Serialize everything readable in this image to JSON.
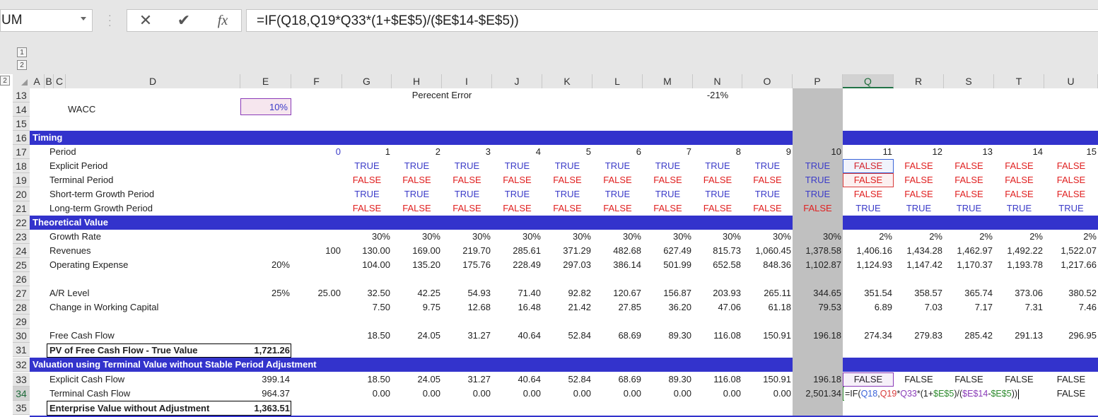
{
  "namebox": {
    "value": "UM"
  },
  "formula_bar": {
    "cancel_icon": "✕",
    "enter_icon": "✔",
    "fx_label": "fx",
    "formula": "=IF(Q18,Q19*Q33*(1+$E$5)/($E$14-$E$5))"
  },
  "outline": {
    "levels": [
      "1",
      "2"
    ],
    "level_2": "2"
  },
  "columns": [
    "A",
    "B",
    "C",
    "D",
    "E",
    "F",
    "G",
    "H",
    "I",
    "J",
    "K",
    "L",
    "M",
    "N",
    "O",
    "P",
    "Q",
    "R",
    "S",
    "T",
    "U"
  ],
  "rows": [
    "13",
    "14",
    "15",
    "16",
    "17",
    "18",
    "19",
    "20",
    "21",
    "22",
    "23",
    "24",
    "25",
    "26",
    "27",
    "28",
    "29",
    "30",
    "31",
    "32",
    "33",
    "34",
    "35"
  ],
  "sections": {
    "timing": "Timing",
    "theoretical": "Theoretical Value",
    "valuation": "Valuation using Terminal Value without Stable Period Adjustment"
  },
  "labels": {
    "perecent_error": "Perecent Error",
    "error_value": "-21%",
    "wacc": "WACC",
    "wacc_value": "10%",
    "period": "Period",
    "explicit_period": "Explicit Period",
    "terminal_period": "Terminal Period",
    "short_term": "Short-term Growth Period",
    "long_term": "Long-term Growth Period",
    "growth_rate": "Growth Rate",
    "revenues": "Revenues",
    "revenues_base": "100",
    "opex": "Operating Expense",
    "opex_pct": "20%",
    "ar_level": "A/R Level",
    "ar_pct": "25%",
    "ar_base": "25.00",
    "change_wc": "Change in Working Capital",
    "fcf": "Free Cash Flow",
    "pv_fcf": "PV of Free Cash Flow - True Value",
    "pv_fcf_value": "1,721.26",
    "explicit_cf": "Explicit Cash Flow",
    "explicit_cf_total": "399.14",
    "terminal_cf": "Terminal Cash Flow",
    "terminal_cf_total": "964.37",
    "ev_wo_adj": "Enterprise Value without Adjustment",
    "ev_wo_adj_value": "1,363.51"
  },
  "period_values": [
    "0",
    "1",
    "2",
    "3",
    "4",
    "5",
    "6",
    "7",
    "8",
    "9",
    "10",
    "11",
    "12",
    "13",
    "14",
    "15"
  ],
  "explicit_period": [
    "TRUE",
    "TRUE",
    "TRUE",
    "TRUE",
    "TRUE",
    "TRUE",
    "TRUE",
    "TRUE",
    "TRUE",
    "TRUE",
    "FALSE",
    "FALSE",
    "FALSE",
    "FALSE",
    "FALSE"
  ],
  "terminal_period": [
    "FALSE",
    "FALSE",
    "FALSE",
    "FALSE",
    "FALSE",
    "FALSE",
    "FALSE",
    "FALSE",
    "FALSE",
    "TRUE",
    "FALSE",
    "FALSE",
    "FALSE",
    "FALSE",
    "FALSE"
  ],
  "short_term": [
    "TRUE",
    "TRUE",
    "TRUE",
    "TRUE",
    "TRUE",
    "TRUE",
    "TRUE",
    "TRUE",
    "TRUE",
    "TRUE",
    "FALSE",
    "FALSE",
    "FALSE",
    "FALSE",
    "FALSE"
  ],
  "long_term": [
    "FALSE",
    "FALSE",
    "FALSE",
    "FALSE",
    "FALSE",
    "FALSE",
    "FALSE",
    "FALSE",
    "FALSE",
    "FALSE",
    "TRUE",
    "TRUE",
    "TRUE",
    "TRUE",
    "TRUE"
  ],
  "growth_rate": [
    "30%",
    "30%",
    "30%",
    "30%",
    "30%",
    "30%",
    "30%",
    "30%",
    "30%",
    "30%",
    "2%",
    "2%",
    "2%",
    "2%",
    "2%"
  ],
  "revenues": [
    "130.00",
    "169.00",
    "219.70",
    "285.61",
    "371.29",
    "482.68",
    "627.49",
    "815.73",
    "1,060.45",
    "1,378.58",
    "1,406.16",
    "1,434.28",
    "1,462.97",
    "1,492.22",
    "1,522.07"
  ],
  "opex": [
    "104.00",
    "135.20",
    "175.76",
    "228.49",
    "297.03",
    "386.14",
    "501.99",
    "652.58",
    "848.36",
    "1,102.87",
    "1,124.93",
    "1,147.42",
    "1,170.37",
    "1,193.78",
    "1,217.66"
  ],
  "ar_level": [
    "32.50",
    "42.25",
    "54.93",
    "71.40",
    "92.82",
    "120.67",
    "156.87",
    "203.93",
    "265.11",
    "344.65",
    "351.54",
    "358.57",
    "365.74",
    "373.06",
    "380.52"
  ],
  "change_wc": [
    "7.50",
    "9.75",
    "12.68",
    "16.48",
    "21.42",
    "27.85",
    "36.20",
    "47.06",
    "61.18",
    "79.53",
    "6.89",
    "7.03",
    "7.17",
    "7.31",
    "7.46"
  ],
  "fcf": [
    "18.50",
    "24.05",
    "31.27",
    "40.64",
    "52.84",
    "68.69",
    "89.30",
    "116.08",
    "150.91",
    "196.18",
    "274.34",
    "279.83",
    "285.42",
    "291.13",
    "296.95"
  ],
  "explicit_cf": [
    "18.50",
    "24.05",
    "31.27",
    "40.64",
    "52.84",
    "68.69",
    "89.30",
    "116.08",
    "150.91",
    "196.18",
    "FALSE",
    "FALSE",
    "FALSE",
    "FALSE",
    "FALSE"
  ],
  "terminal_cf": [
    "0.00",
    "0.00",
    "0.00",
    "0.00",
    "0.00",
    "0.00",
    "0.00",
    "0.00",
    "0.00",
    "2,501.34"
  ],
  "editing": {
    "q34_formula_parts": [
      "=IF(",
      "Q18",
      ",",
      "Q19",
      "*",
      "Q33",
      "*(1+",
      "$E$5",
      ")/(",
      "$E$14",
      "-",
      "$E$5",
      "))"
    ],
    "u34": "FALSE"
  },
  "colors": {
    "band": "#3333cc",
    "true_text": "#3b3bc8",
    "false_text": "#e02020",
    "selected_column": "#c0c0c0",
    "ref_blue": "#3b64d8",
    "ref_red": "#d83b3b",
    "ref_purple": "#8a3bb8",
    "ref_green": "#2e8b2e"
  }
}
